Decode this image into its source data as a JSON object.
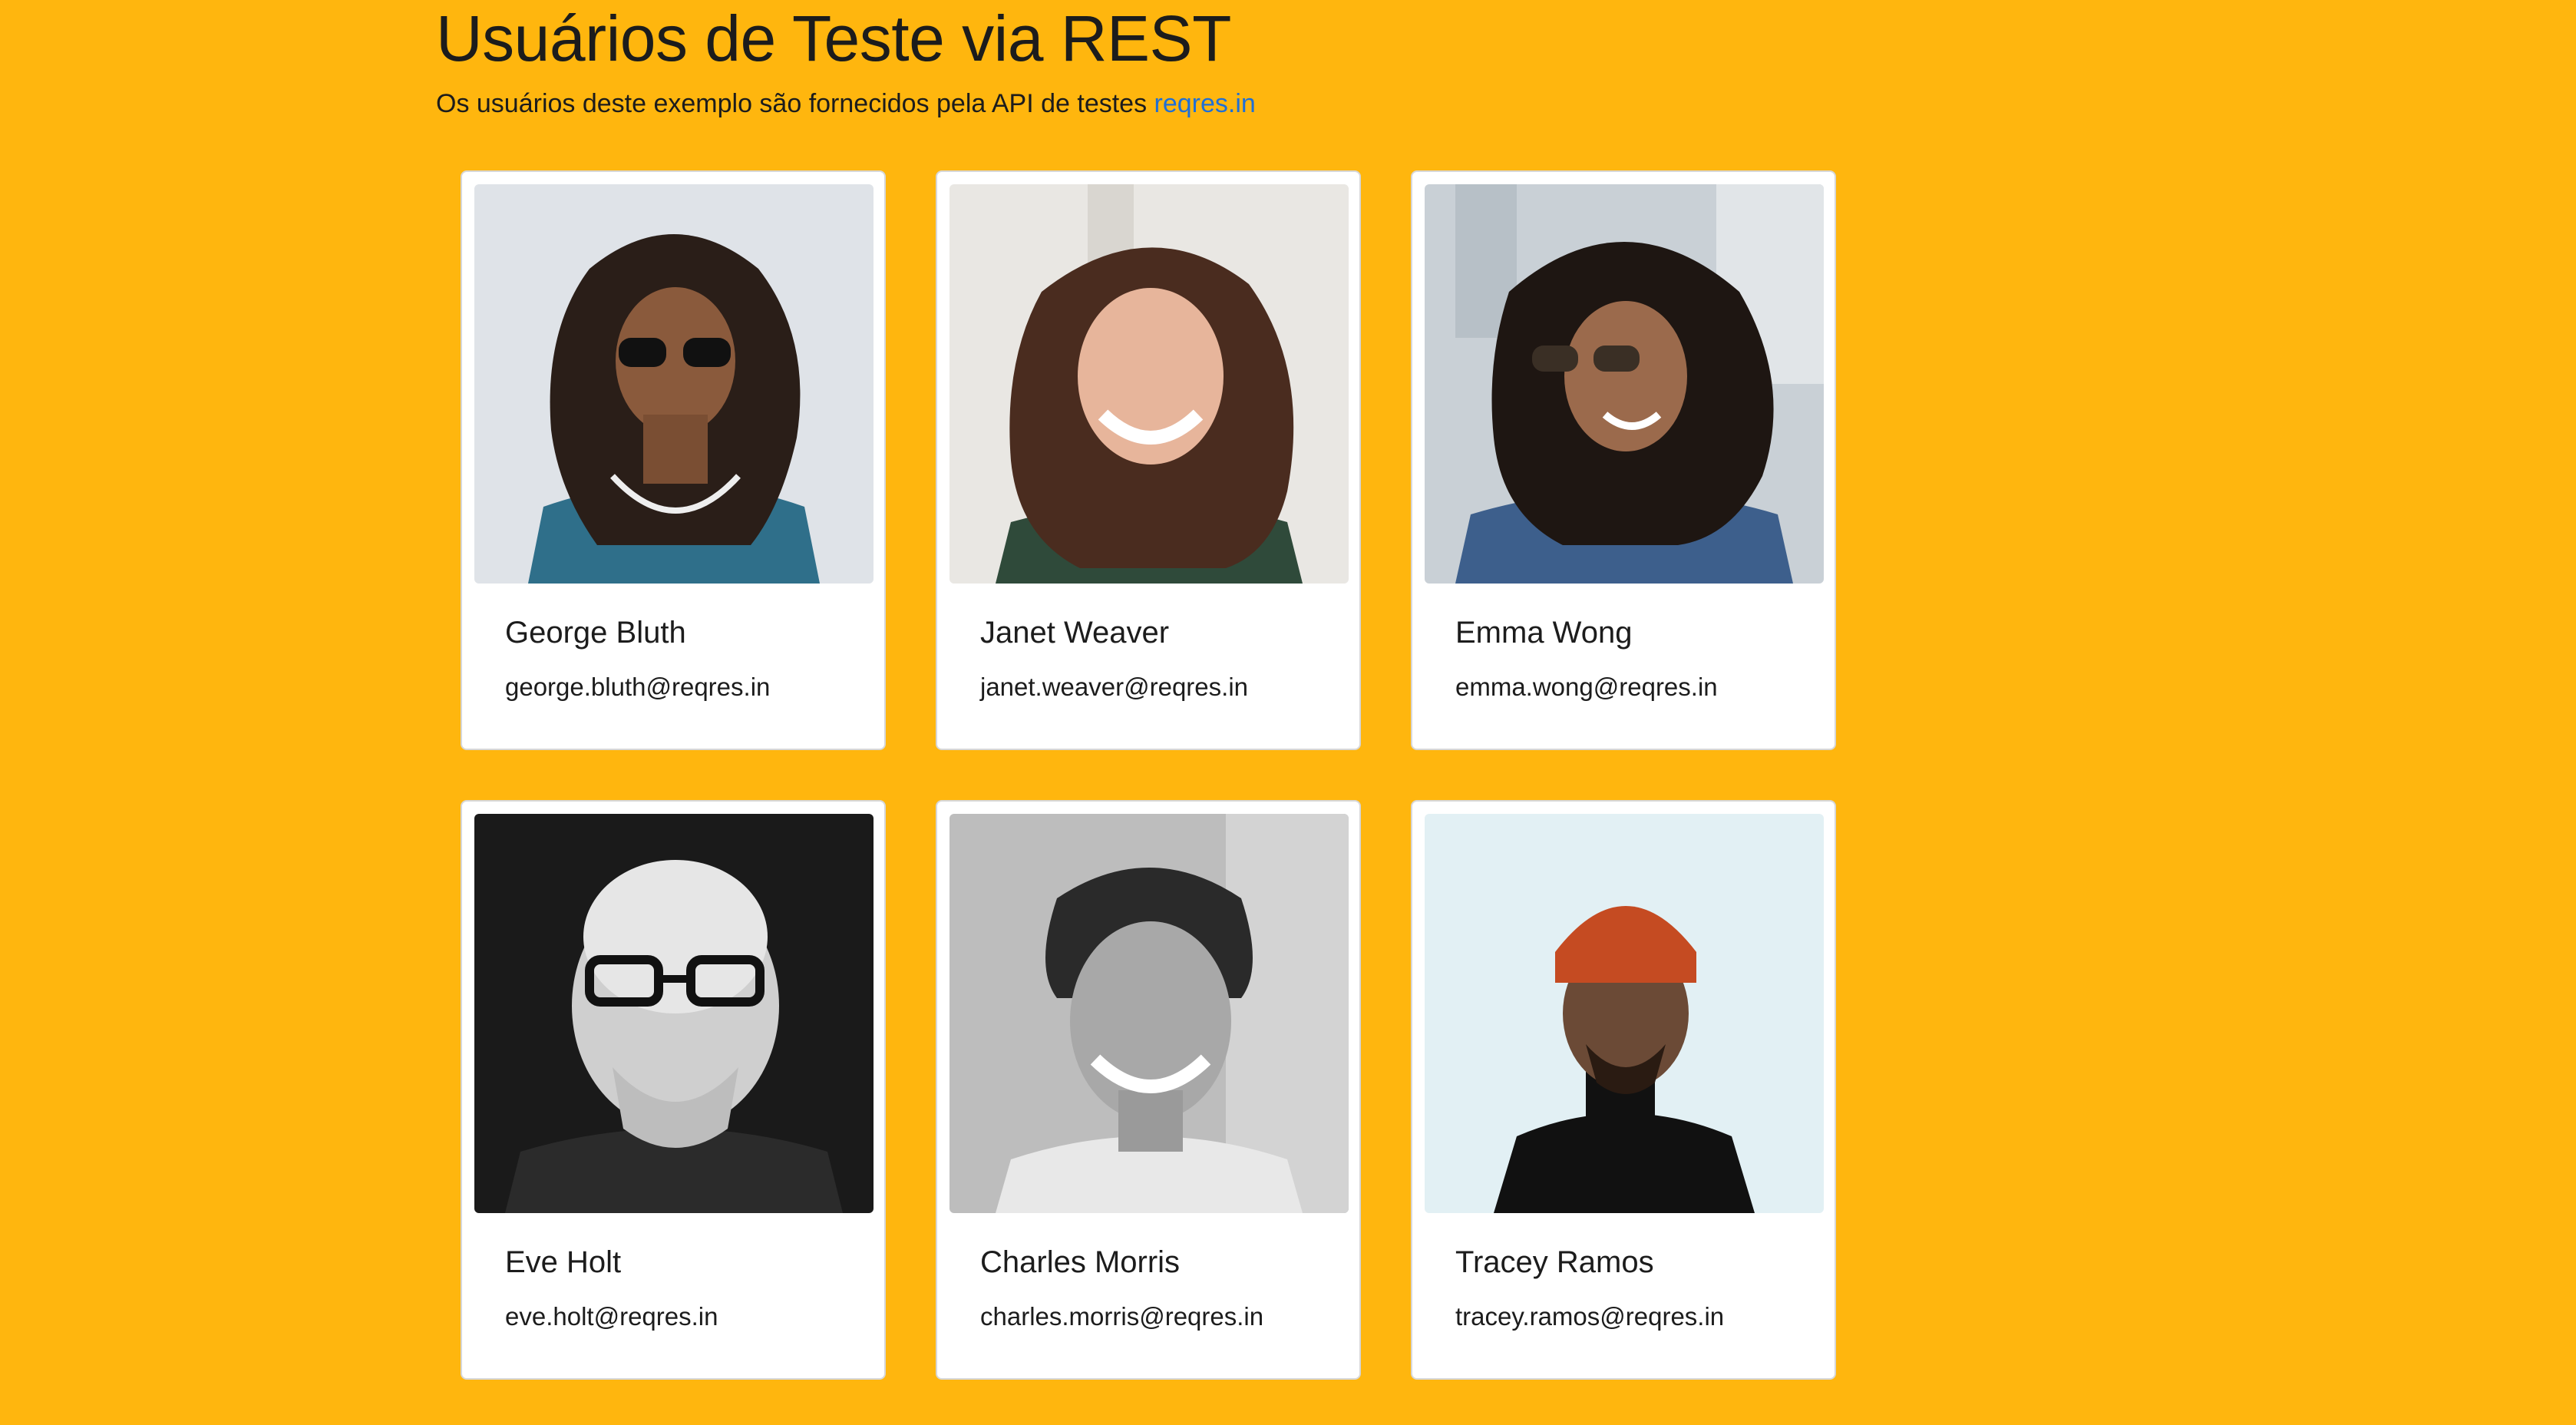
{
  "header": {
    "title": "Usuários de Teste via REST",
    "subtitle_prefix": "Os usuários deste exemplo são fornecidos pela API de testes ",
    "subtitle_link": "reqres.in"
  },
  "users": [
    {
      "name": "George Bluth",
      "email": "george.bluth@reqres.in"
    },
    {
      "name": "Janet Weaver",
      "email": "janet.weaver@reqres.in"
    },
    {
      "name": "Emma Wong",
      "email": "emma.wong@reqres.in"
    },
    {
      "name": "Eve Holt",
      "email": "eve.holt@reqres.in"
    },
    {
      "name": "Charles Morris",
      "email": "charles.morris@reqres.in"
    },
    {
      "name": "Tracey Ramos",
      "email": "tracey.ramos@reqres.in"
    }
  ],
  "colors": {
    "background": "#FFB60E",
    "card": "#FFFFFF",
    "link": "#1F6FD6",
    "text": "#1C1C1C"
  }
}
